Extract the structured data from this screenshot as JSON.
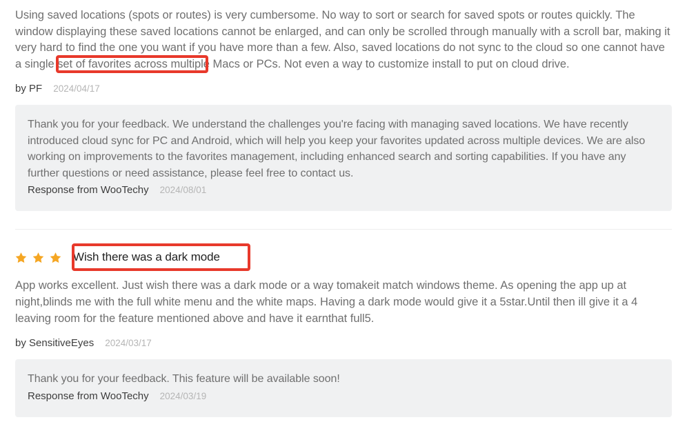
{
  "colors": {
    "annotation_red": "#e8392b",
    "star_gold": "#f5a623",
    "response_bg": "#f0f1f2",
    "body_text": "#6f6f6f",
    "date_text": "#b5b5b5"
  },
  "reviews": [
    {
      "body": "Using saved locations (spots or routes) is very cumbersome. No way to sort or search for saved spots or routes quickly. The window displaying these saved locations cannot be enlarged, and can only be scrolled through manually with a scroll bar, making it very hard to find the one you want if you have more than a few. Also, saved locations do not sync to the cloud so one cannot have a single set of favorites across multiple Macs or PCs. Not even a way to customize install to put on cloud drive.",
      "by_label": "by PF",
      "date": "2024/04/17",
      "response": {
        "text": "Thank you for your feedback. We understand the challenges you're facing with managing saved locations. We have recently introduced cloud sync for PC and Android, which will help you keep your favorites updated across multiple devices. We are also working on improvements to the favorites management, including enhanced search and sorting capabilities. If you have any further questions or need assistance, please feel free to contact us.",
        "from_label": "Response from WooTechy",
        "date": "2024/08/01"
      }
    },
    {
      "rating": 3,
      "title": "Wish there was a dark mode",
      "body": "App works excellent. Just wish there was a dark mode or a way tomakeit match windows theme. As opening the app up at night,blinds me with the full white menu and the white maps. Having a dark mode would give it a 5star.Until then ill give it a 4 leaving room for the feature mentioned above and have it earnthat full5.",
      "by_label": "by SensitiveEyes",
      "date": "2024/03/17",
      "response": {
        "text": "Thank you for your feedback. This feature will be available soon!",
        "from_label": "Response from WooTechy",
        "date": "2024/03/19"
      }
    }
  ],
  "annotations": [
    {
      "label": "across multiple Macs or PCs."
    },
    {
      "label": "Wish there was a dark mode"
    }
  ]
}
